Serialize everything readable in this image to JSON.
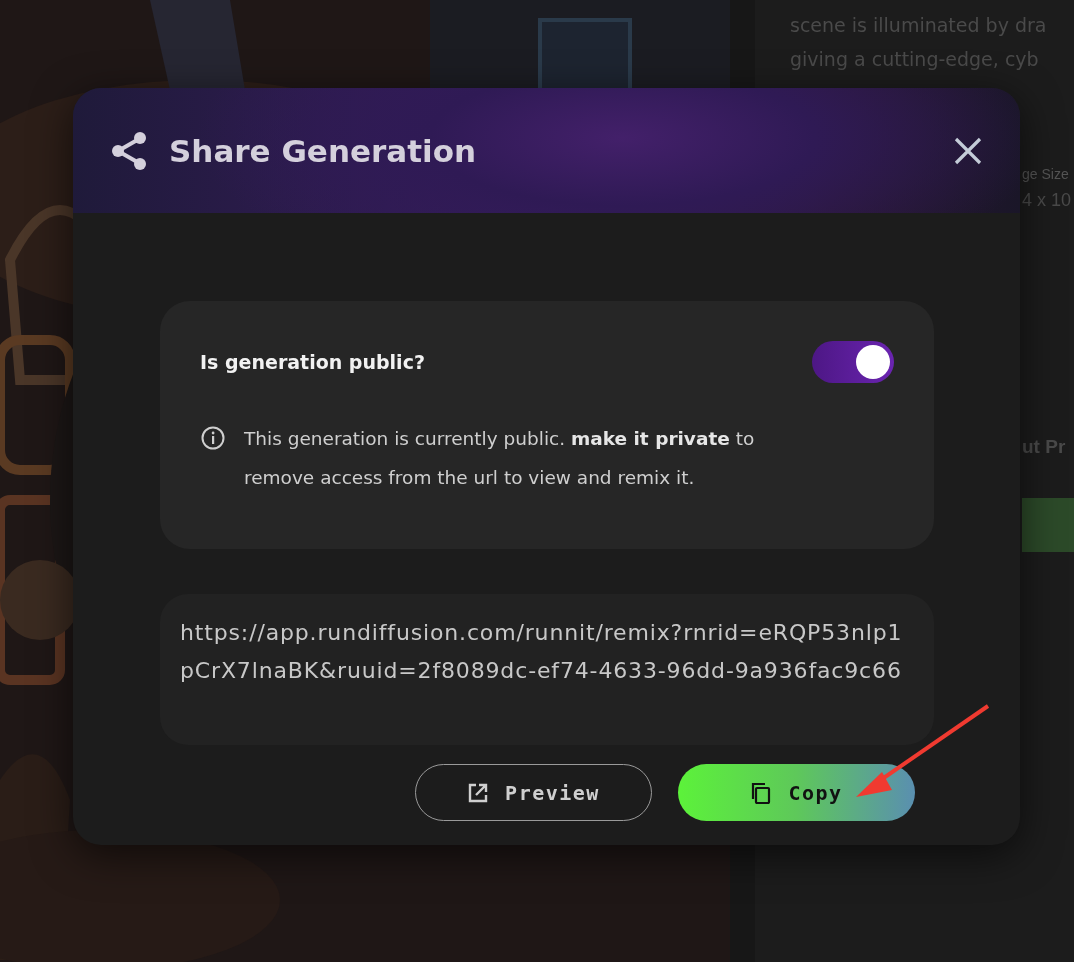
{
  "background": {
    "description_lines": [
      "scene is illuminated by dra",
      "giving a cutting-edge, cyb"
    ],
    "image_size_label": "ge Size",
    "image_size_value": "4 x 10",
    "section_label": "ut Pr"
  },
  "dialog": {
    "title": "Share Generation",
    "public_toggle": {
      "label": "Is generation public?",
      "on": true
    },
    "info": "This generation is currently public. **make it private** to remove access from the url to view and remix it.",
    "url": "https://app.rundiffusion.com/runnit/remix?rnrid=eRQP53nlp1pCrX7lnaBK&ruuid=2f8089dc-ef74-4633-96dd-9a936fac9c66",
    "buttons": [
      {
        "label": "Preview",
        "kind": "outline"
      },
      {
        "label": "Copy",
        "kind": "primary"
      }
    ]
  }
}
